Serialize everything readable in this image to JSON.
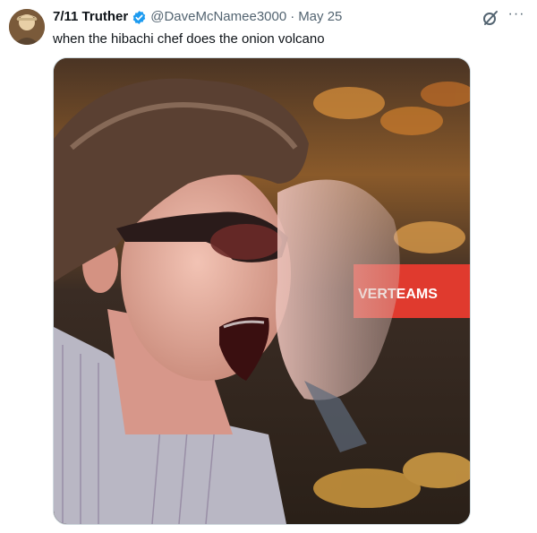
{
  "tweet": {
    "display_name": "7/11 Truther",
    "handle": "@DaveMcNamee3000",
    "separator": "·",
    "timestamp": "May 25",
    "text": "when the hibachi chef does the onion volcano",
    "verified": true,
    "more_label": "···"
  },
  "media": {
    "kind": "photo",
    "banner_text": "VERTEAMS"
  },
  "colors": {
    "verified_badge": "#1d9bf0",
    "secondary_text": "#536471",
    "banner_red": "#e03a2e"
  },
  "icons": [
    "avatar",
    "verified-badge-icon",
    "grok-icon",
    "more-icon"
  ]
}
